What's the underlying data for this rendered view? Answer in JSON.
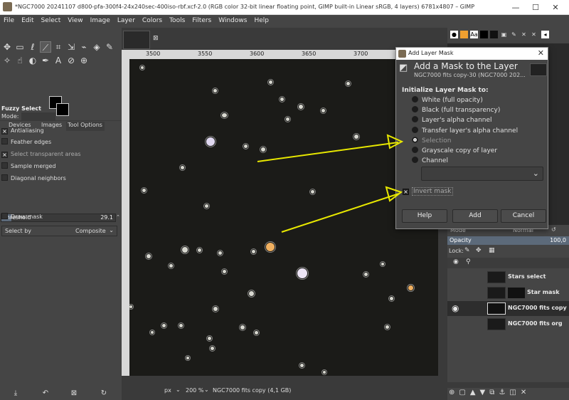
{
  "window": {
    "title": "*NGC7000 20241107 d800-pfa-300f4-24x240sec-400iso-rbf.xcf-2.0 (RGB color 32-bit linear floating point, GIMP built-in Linear sRGB, 4 layers) 6781x4807 – GIMP",
    "controls": [
      "—",
      "☐",
      "✕"
    ]
  },
  "menu": [
    "File",
    "Edit",
    "Select",
    "View",
    "Image",
    "Layer",
    "Colors",
    "Tools",
    "Filters",
    "Windows",
    "Help"
  ],
  "toolbox": {
    "tabs": [
      "Devices",
      "Images",
      "Tool Options"
    ],
    "tool_name": "Fuzzy Select",
    "mode_label": "Mode:",
    "options": [
      {
        "label": "Antialiasing",
        "checked": true
      },
      {
        "label": "Feather edges",
        "checked": false
      },
      {
        "label": "Select transparent areas",
        "checked": true
      },
      {
        "label": "Sample merged",
        "checked": false
      },
      {
        "label": "Diagonal neighbors",
        "checked": false
      }
    ],
    "threshold_label": "Threshold",
    "threshold_value": "29.1",
    "select_by_label": "Select by",
    "select_by_value": "Composite",
    "draw_mask": "Draw mask",
    "bottom_icons": [
      "⤓",
      "↶",
      "⊠",
      "↻"
    ]
  },
  "ruler": {
    "ticks": [
      "3500",
      "3550",
      "3600",
      "3650",
      "3700"
    ]
  },
  "status": {
    "unit": "px",
    "zoom": "200 %",
    "info": "NGC7000 fits copy (4,1 GB)"
  },
  "dialog": {
    "window_title": "Add Layer Mask",
    "heading": "Add a Mask to the Layer",
    "subheading": "NGC7000 fits copy-30 (NGC7000 202...",
    "section": "Initialize Layer Mask to:",
    "options": [
      {
        "label": "White (full opacity)",
        "selected": false,
        "enabled": true
      },
      {
        "label": "Black (full transparency)",
        "selected": false,
        "enabled": true
      },
      {
        "label": "Layer's alpha channel",
        "selected": false,
        "enabled": true
      },
      {
        "label": "Transfer layer's alpha channel",
        "selected": false,
        "enabled": true
      },
      {
        "label": "Selection",
        "selected": true,
        "enabled": false
      },
      {
        "label": "Grayscale copy of layer",
        "selected": false,
        "enabled": true
      },
      {
        "label": "Channel",
        "selected": false,
        "enabled": true
      }
    ],
    "invert_mask": "Invert mask",
    "buttons": {
      "help": "Help",
      "add": "Add",
      "cancel": "Cancel"
    }
  },
  "layers": {
    "mode_label": "Mode",
    "mode_value": "Normal",
    "opacity_label": "Opacity",
    "opacity_value": "100,0",
    "lock_label": "Lock:",
    "items": [
      {
        "name": "Stars select",
        "visible": false,
        "selected": false
      },
      {
        "name": "Star mask",
        "visible": false,
        "selected": false
      },
      {
        "name": "NGC7000 fits copy",
        "visible": true,
        "selected": true
      },
      {
        "name": "NGC7000 fits org",
        "visible": false,
        "selected": false
      }
    ]
  },
  "colors": {
    "accent": "#e8e800",
    "panel": "#454545",
    "canvas": "#1b1b18"
  }
}
